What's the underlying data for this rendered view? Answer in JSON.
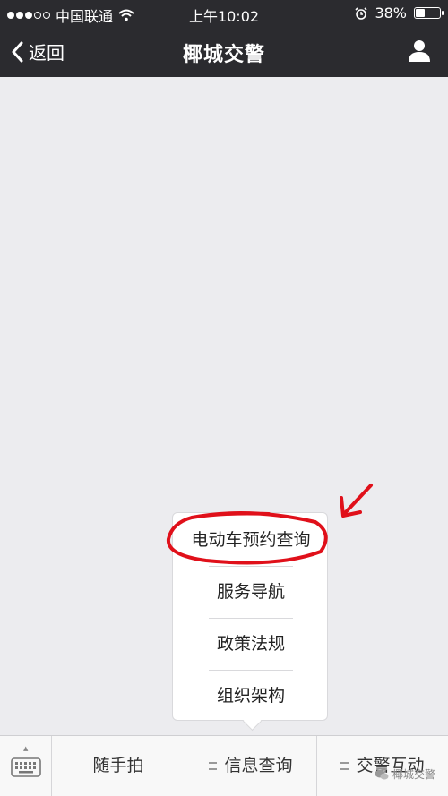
{
  "status_bar": {
    "carrier": "中国联通",
    "time": "上午10:02",
    "battery_percent": "38%",
    "battery_level": 0.38
  },
  "nav": {
    "back_label": "返回",
    "title": "椰城交警"
  },
  "popup_menu": {
    "items": [
      {
        "label": "电动车预约查询"
      },
      {
        "label": "服务导航"
      },
      {
        "label": "政策法规"
      },
      {
        "label": "组织架构"
      }
    ]
  },
  "bottom_menu": {
    "tabs": [
      {
        "label": "随手拍"
      },
      {
        "label": "信息查询"
      },
      {
        "label": "交警互动"
      }
    ]
  },
  "watermark": "椰城交警",
  "colors": {
    "bar_background": "#2b2b2f",
    "page_background": "#ececef",
    "annotation_red": "#e0101a"
  }
}
